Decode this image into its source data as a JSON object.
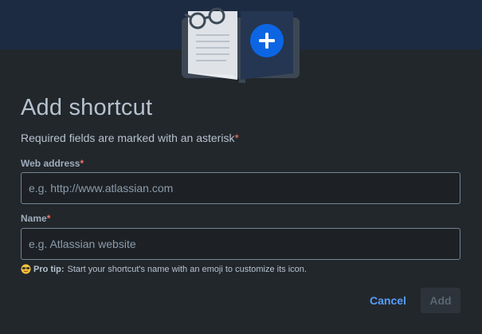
{
  "dialog": {
    "title": "Add shortcut",
    "required_note": "Required fields are marked with an asterisk",
    "required_mark": "*",
    "illustration_icon": "book-with-glasses-plus-illustration"
  },
  "fields": {
    "web_address": {
      "label": "Web address",
      "required_mark": "*",
      "value": "",
      "placeholder": "e.g. http://www.atlassian.com"
    },
    "name": {
      "label": "Name",
      "required_mark": "*",
      "value": "",
      "placeholder": "e.g. Atlassian website"
    }
  },
  "tip": {
    "emoji_icon": "smiling-face-with-sunglasses-icon",
    "bold": "Pro tip:",
    "text": "Start your shortcut's name with an emoji to customize its icon."
  },
  "actions": {
    "cancel_label": "Cancel",
    "add_label": "Add",
    "add_disabled": true
  },
  "colors": {
    "background": "#22272b",
    "header": "#1c2b41",
    "link": "#579dff",
    "asterisk": "#f87168",
    "plus_badge": "#0c66e4"
  }
}
